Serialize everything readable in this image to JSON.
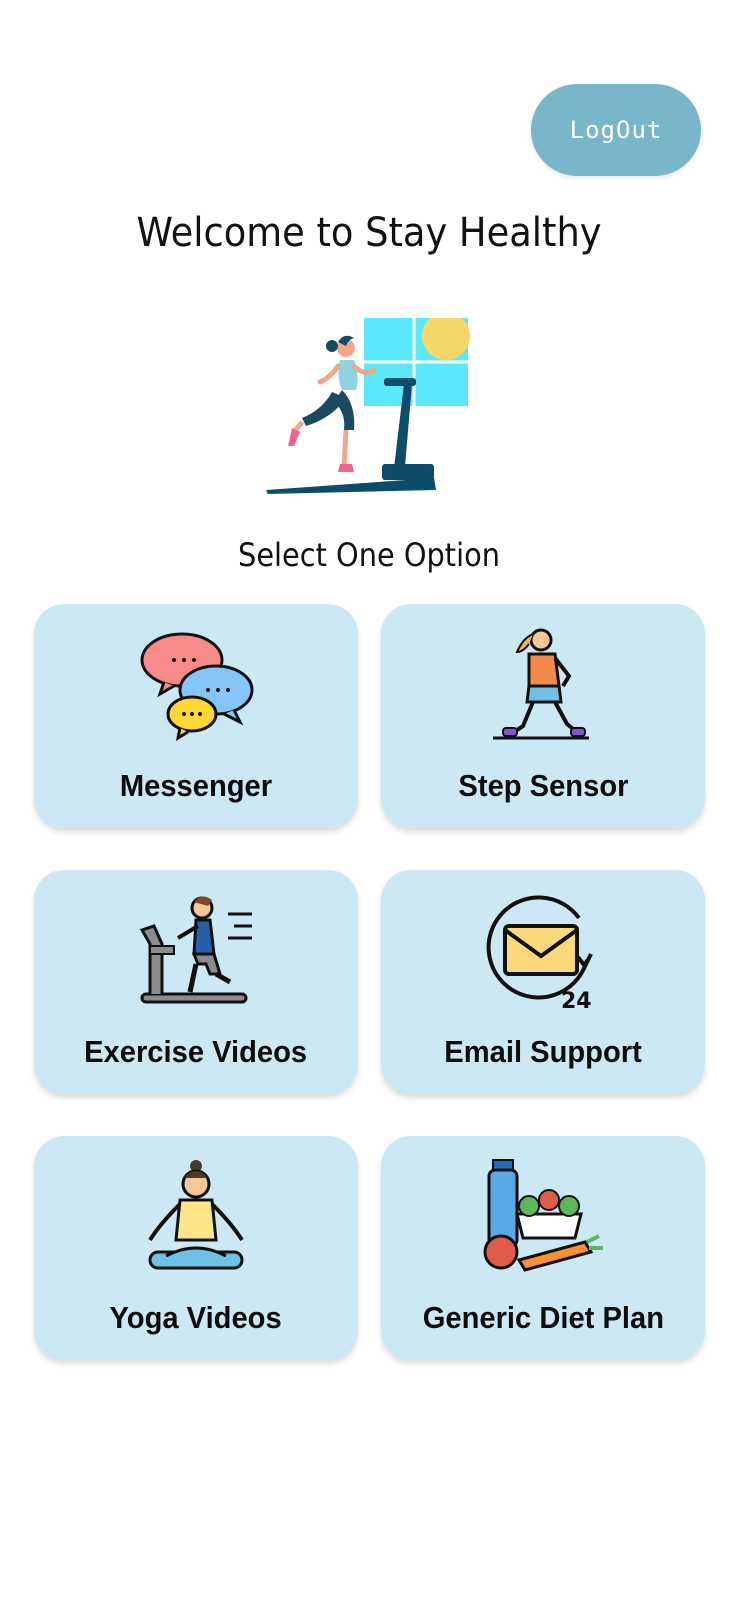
{
  "header": {
    "logout_label": "LogOut"
  },
  "welcome_title": "Welcome to Stay Healthy",
  "hero_icon": "treadmill-runner-icon",
  "select_prompt": "Select One Option",
  "options": [
    {
      "label": "Messenger",
      "icon": "chat-bubbles-icon"
    },
    {
      "label": "Step Sensor",
      "icon": "walking-person-icon"
    },
    {
      "label": "Exercise Videos",
      "icon": "treadmill-icon"
    },
    {
      "label": "Email Support",
      "icon": "email-24-icon"
    },
    {
      "label": "Yoga Videos",
      "icon": "yoga-icon"
    },
    {
      "label": "Generic Diet Plan",
      "icon": "diet-food-icon"
    }
  ],
  "colors": {
    "logout_button": "#7ab6c9",
    "card_background": "#cde8f5",
    "background": "#ffffff"
  }
}
